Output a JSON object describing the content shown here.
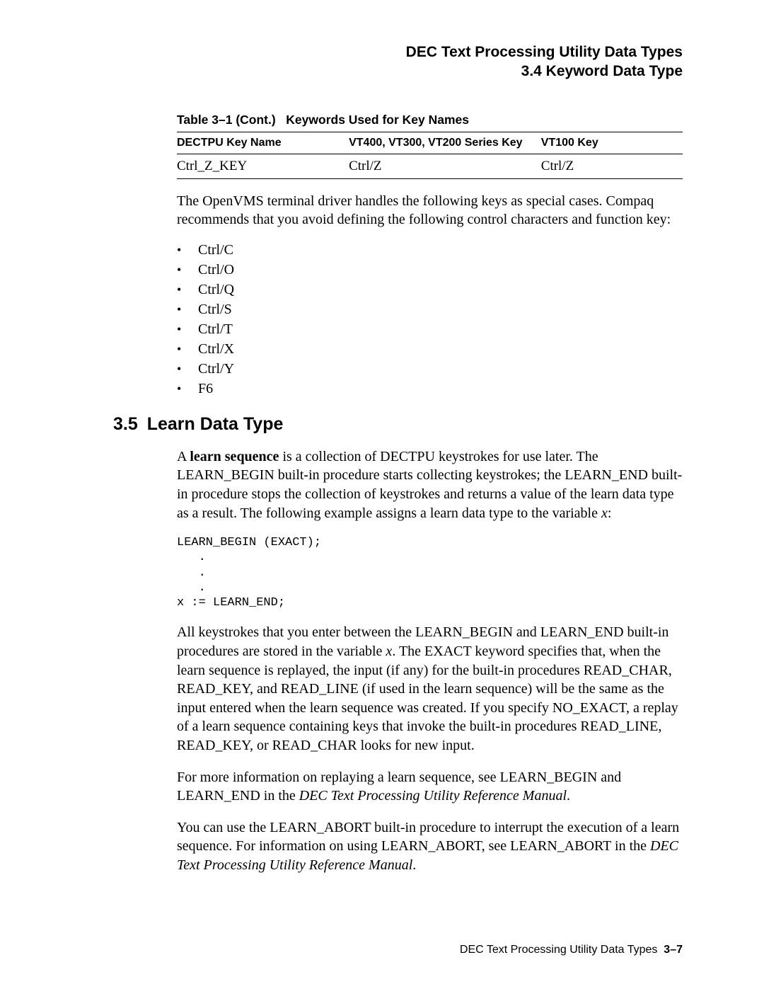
{
  "header": {
    "line1": "DEC Text Processing Utility Data Types",
    "line2": "3.4 Keyword Data Type"
  },
  "table": {
    "caption_label": "Table 3–1 (Cont.)",
    "caption_title": "Keywords Used for Key Names",
    "headers": {
      "col1": "DECTPU Key Name",
      "col2": "VT400, VT300, VT200 Series Key",
      "col3": "VT100 Key"
    },
    "row": {
      "col1": "Ctrl_Z_KEY",
      "col2": "Ctrl/Z",
      "col3": "Ctrl/Z"
    }
  },
  "para1": "The OpenVMS terminal driver handles the following keys as special cases. Compaq recommends that you avoid defining the following control characters and function key:",
  "keys": [
    "Ctrl/C",
    "Ctrl/O",
    "Ctrl/Q",
    "Ctrl/S",
    "Ctrl/T",
    "Ctrl/X",
    "Ctrl/Y",
    "F6"
  ],
  "section": {
    "number": "3.5",
    "title": "Learn Data Type"
  },
  "learn": {
    "p1_pre": "A ",
    "p1_bold": "learn sequence",
    "p1_post": " is a collection of DECTPU keystrokes for use later. The LEARN_BEGIN built-in procedure starts collecting keystrokes; the LEARN_END built-in procedure stops the collection of keystrokes and returns a value of the learn data type as a result. The following example assigns a learn data type to the variable ",
    "p1_var": "x",
    "p1_end": ":",
    "code": "LEARN_BEGIN (EXACT);\n   .\n   .\n   .\nx := LEARN_END;",
    "p2_a": "All keystrokes that you enter between the LEARN_BEGIN and LEARN_END built-in procedures are stored in the variable ",
    "p2_var": "x",
    "p2_b": ". The EXACT keyword specifies that, when the learn sequence is replayed, the input (if any) for the built-in procedures READ_CHAR, READ_KEY, and READ_LINE (if used in the learn sequence) will be the same as the input entered when the learn sequence was created. If you specify NO_EXACT, a replay of a learn sequence containing keys that invoke the built-in procedures READ_LINE, READ_KEY, or READ_CHAR looks for new input.",
    "p3_a": "For more information on replaying a learn sequence, see LEARN_BEGIN and LEARN_END in the ",
    "p3_ref": "DEC Text Processing Utility Reference Manual",
    "p3_b": ".",
    "p4_a": "You can use the LEARN_ABORT built-in procedure to interrupt the execution of a learn sequence. For information on using LEARN_ABORT, see LEARN_ABORT in the ",
    "p4_ref": "DEC Text Processing Utility Reference Manual",
    "p4_b": "."
  },
  "footer": {
    "text": "DEC Text Processing Utility Data Types",
    "page": "3–7"
  }
}
